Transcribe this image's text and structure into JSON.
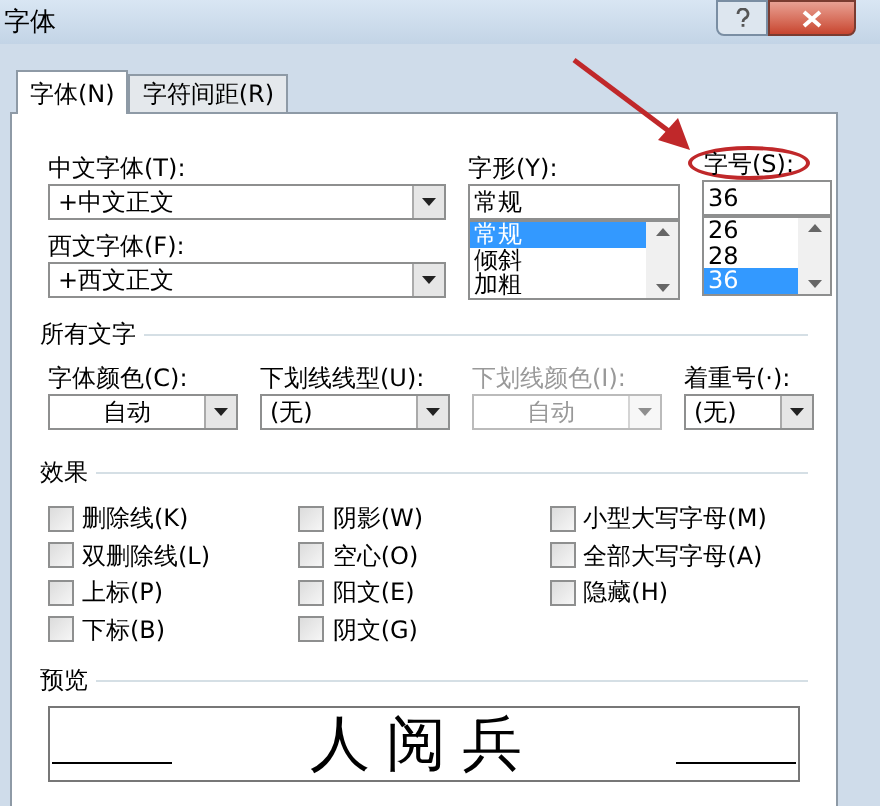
{
  "window": {
    "title": "字体"
  },
  "tabs": [
    {
      "label": "字体(N)",
      "selected": true
    },
    {
      "label": "字符间距(R)",
      "selected": false
    }
  ],
  "font": {
    "chinese_label": "中文字体(T):",
    "chinese_value": "+中文正文",
    "western_label": "西文字体(F):",
    "western_value": "+西文正文"
  },
  "style": {
    "label": "字形(Y):",
    "value": "常规",
    "options": [
      {
        "label": "常规",
        "selected": true
      },
      {
        "label": "倾斜",
        "selected": false
      },
      {
        "label": "加粗",
        "selected": false
      }
    ]
  },
  "size": {
    "label": "字号(S):",
    "value": "36",
    "options": [
      {
        "label": "26",
        "selected": false
      },
      {
        "label": "28",
        "selected": false
      },
      {
        "label": "36",
        "selected": true
      }
    ]
  },
  "all_text": {
    "heading": "所有文字",
    "fields": [
      {
        "label": "字体颜色(C):",
        "value": "自动",
        "disabled": false,
        "centered": true
      },
      {
        "label": "下划线线型(U):",
        "value": "(无)",
        "disabled": false,
        "centered": false
      },
      {
        "label": "下划线颜色(I):",
        "value": "自动",
        "disabled": true,
        "centered": true
      },
      {
        "label": "着重号(·):",
        "value": "(无)",
        "disabled": false,
        "centered": false
      }
    ]
  },
  "effects": {
    "heading": "效果",
    "columns": [
      [
        {
          "label": "删除线(K)",
          "checked": false
        },
        {
          "label": "双删除线(L)",
          "checked": false
        },
        {
          "label": "上标(P)",
          "checked": false
        },
        {
          "label": "下标(B)",
          "checked": false
        }
      ],
      [
        {
          "label": "阴影(W)",
          "checked": false
        },
        {
          "label": "空心(O)",
          "checked": false
        },
        {
          "label": "阳文(E)",
          "checked": false
        },
        {
          "label": "阴文(G)",
          "checked": false
        }
      ],
      [
        {
          "label": "小型大写字母(M)",
          "checked": false
        },
        {
          "label": "全部大写字母(A)",
          "checked": false
        },
        {
          "label": "隐藏(H)",
          "checked": false
        }
      ]
    ]
  },
  "preview": {
    "heading": "预览",
    "text": "人阅兵"
  },
  "annotation": {
    "size_label_circled": true
  }
}
